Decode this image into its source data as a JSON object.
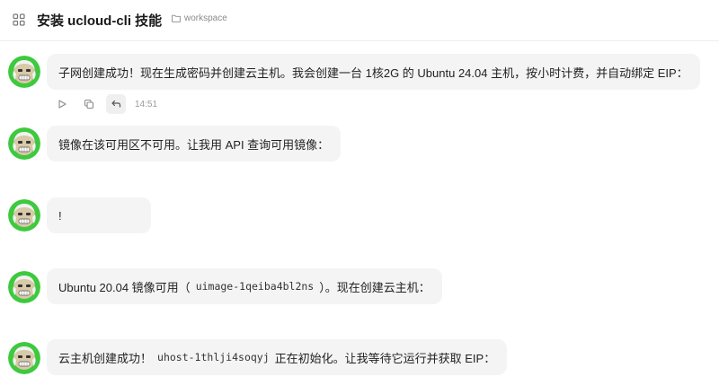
{
  "header": {
    "title": "安装 ucloud-cli 技能",
    "workspace": "workspace"
  },
  "messages": [
    {
      "text": "子网创建成功！现在生成密码并创建云主机。我会创建一台 1核2G 的 Ubuntu 24.04 主机，按小时计费，并自动绑定 EIP：",
      "time": "14:51"
    },
    {
      "text": "镜像在该可用区不可用。让我用 API 查询可用镜像："
    },
    {
      "text": "!"
    },
    {
      "pre": "Ubuntu 20.04 镜像可用（",
      "code": "uimage-1qeiba4bl2ns",
      "post": "）。现在创建云主机："
    },
    {
      "pre": "云主机创建成功！",
      "code": "uhost-1thlji4soqyj",
      "post": "正在初始化。让我等待它运行并获取 EIP："
    }
  ],
  "colors": {
    "avatar_ring": "#3ec93e",
    "bubble": "#f4f4f4",
    "accent": "#1a1a1a"
  }
}
